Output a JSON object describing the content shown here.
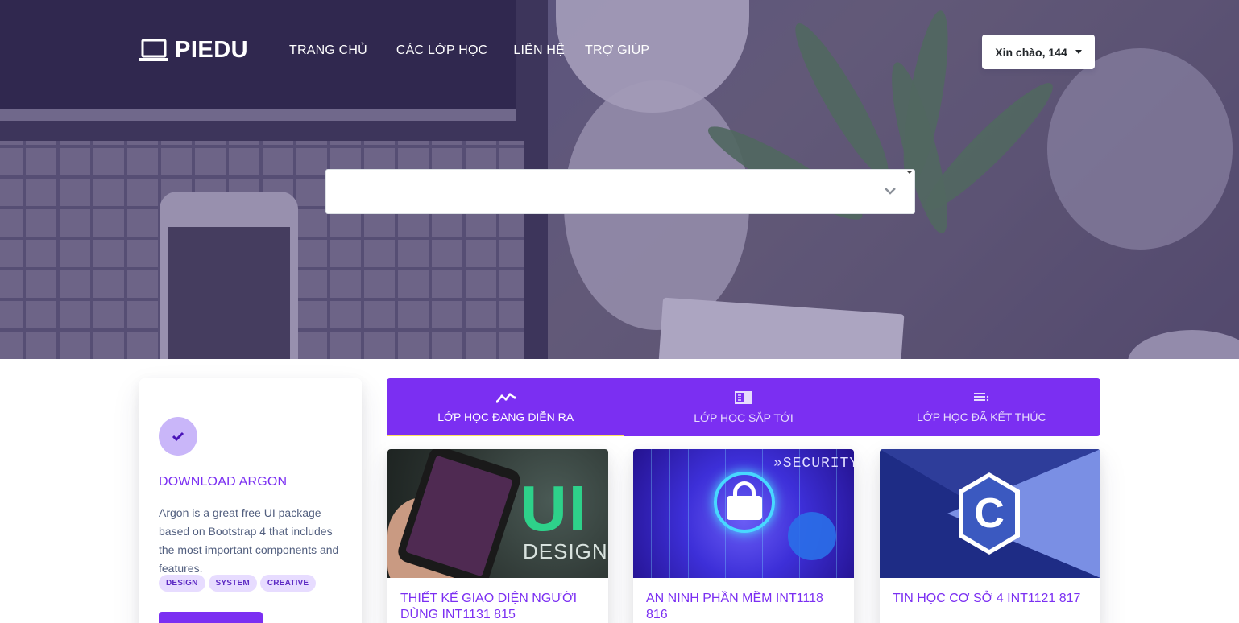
{
  "brand": {
    "name": "PIEDU"
  },
  "nav": {
    "items": [
      {
        "label": "TRANG CHỦ"
      },
      {
        "label": "CÁC LỚP HỌC"
      },
      {
        "label": "LIÊN HỆ"
      },
      {
        "label": "TRỢ GIÚP"
      }
    ]
  },
  "user_menu": {
    "label": "Xin chào, 144"
  },
  "search": {
    "value": ""
  },
  "feature": {
    "title": "DOWNLOAD ARGON",
    "description": "Argon is a great free UI package based on Bootstrap 4 that includes the most important components and features.",
    "badges": [
      "DESIGN",
      "SYSTEM",
      "CREATIVE"
    ]
  },
  "tabs": [
    {
      "label": "LỚP HỌC ĐANG DIỄN RA",
      "icon": "chart-line-icon",
      "active": true
    },
    {
      "label": "LỚP HỌC SẮP TỚI",
      "icon": "book-icon",
      "active": false
    },
    {
      "label": "LỚP HỌC ĐÃ KẾT THÚC",
      "icon": "list-icon",
      "active": false
    }
  ],
  "courses": [
    {
      "title": "THIẾT KẾ GIAO DIỆN NGƯỜI DÙNG INT1131 815",
      "thumb_text": [
        "UI",
        "DESIGN"
      ]
    },
    {
      "title": "AN NINH PHẦN MỀM INT1118 816",
      "thumb_text": [
        "»SECURITY"
      ]
    },
    {
      "title": "TIN HỌC CƠ SỞ 4 INT1121 817",
      "thumb_text": [
        "C"
      ]
    }
  ],
  "colors": {
    "primary": "#7b2ff2",
    "badge_bg": "#e7dcff",
    "tab_indicator": "#ffe066"
  }
}
